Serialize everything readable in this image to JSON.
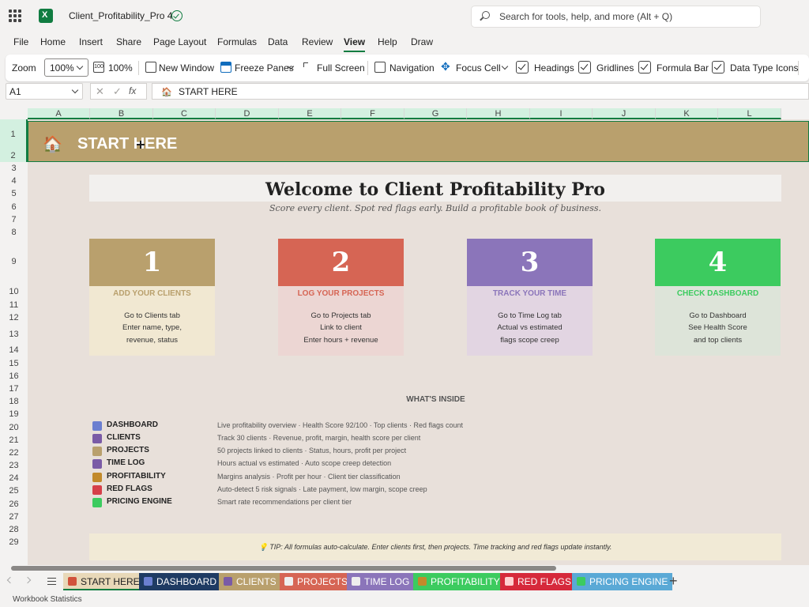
{
  "title_bar": {
    "doc_title": "Client_Profitability_Pro 4",
    "search_placeholder": "Search for tools, help, and more (Alt + Q)"
  },
  "menu": [
    "File",
    "Home",
    "Insert",
    "Share",
    "Page Layout",
    "Formulas",
    "Data",
    "Review",
    "View",
    "Help",
    "Draw"
  ],
  "active_menu": "View",
  "ribbon": {
    "zoom_label": "Zoom",
    "zoom_value": "100%",
    "zoom_100": "100%",
    "new_window": "New Window",
    "freeze_panes": "Freeze Panes",
    "full_screen": "Full Screen",
    "navigation": "Navigation",
    "focus_cell": "Focus Cell",
    "headings": "Headings",
    "gridlines": "Gridlines",
    "formula_bar": "Formula Bar",
    "data_type_icons": "Data Type Icons"
  },
  "formula_bar": {
    "cell_ref": "A1",
    "fx": "fx",
    "content": "START HERE"
  },
  "columns": [
    "A",
    "B",
    "C",
    "D",
    "E",
    "F",
    "G",
    "H",
    "I",
    "J",
    "K",
    "L"
  ],
  "rows": [
    "1",
    "2",
    "3",
    "4",
    "5",
    "6",
    "7",
    "8",
    "9",
    "10",
    "11",
    "12",
    "13",
    "14",
    "15",
    "16",
    "17",
    "18",
    "19",
    "20",
    "21",
    "22",
    "23",
    "24",
    "25",
    "26",
    "27",
    "28",
    "29"
  ],
  "sheet": {
    "banner_title": "START HERE",
    "welcome": "Welcome to Client Profitability Pro",
    "tagline": "Score every client. Spot red flags early. Build a profitable book of business.",
    "steps": [
      {
        "num": "1",
        "title": "ADD YOUR CLIENTS",
        "lines": [
          "Go to Clients tab",
          "Enter name, type,",
          "revenue, status"
        ],
        "top_color": "#b9a06d",
        "bottom_color": "#f1e8d2",
        "title_color": "#b9a06d"
      },
      {
        "num": "2",
        "title": "LOG YOUR PROJECTS",
        "lines": [
          "Go to Projects tab",
          "Link to client",
          "Enter hours + revenue"
        ],
        "top_color": "#d66554",
        "bottom_color": "#ecd6d3",
        "title_color": "#d66554"
      },
      {
        "num": "3",
        "title": "TRACK YOUR TIME",
        "lines": [
          "Go to Time Log tab",
          "Actual vs estimated",
          "flags scope creep"
        ],
        "top_color": "#8b75ba",
        "bottom_color": "#e2d5e2",
        "title_color": "#8b75ba"
      },
      {
        "num": "4",
        "title": "CHECK DASHBOARD",
        "lines": [
          "Go to Dashboard",
          "See Health Score",
          "and top clients"
        ],
        "top_color": "#3ccb5f",
        "bottom_color": "#dde4d9",
        "title_color": "#3ccb5f"
      }
    ],
    "inside_title": "WHAT'S INSIDE",
    "features": [
      {
        "name": "DASHBOARD",
        "desc": "Live profitability overview · Health Score 92/100 · Top clients · Red flags count",
        "icon_color": "#6b7fd0"
      },
      {
        "name": "CLIENTS",
        "desc": "Track 30 clients · Revenue, profit, margin, health score per client",
        "icon_color": "#7a5ba6"
      },
      {
        "name": "PROJECTS",
        "desc": "50 projects linked to clients · Status, hours, profit per project",
        "icon_color": "#b9a06d"
      },
      {
        "name": "TIME LOG",
        "desc": "Hours actual vs estimated · Auto scope creep detection",
        "icon_color": "#7a5ba6"
      },
      {
        "name": "PROFITABILITY",
        "desc": "Margins analysis · Profit per hour · Client tier classification",
        "icon_color": "#c28a2b"
      },
      {
        "name": "RED FLAGS",
        "desc": "Auto-detect 5 risk signals · Late payment, low margin, scope creep",
        "icon_color": "#d6404a"
      },
      {
        "name": "PRICING ENGINE",
        "desc": "Smart rate recommendations per client tier",
        "icon_color": "#3ccb5f"
      }
    ],
    "tip": "TIP: All formulas auto-calculate. Enter clients first, then projects. Time tracking and red flags update instantly."
  },
  "tabs": [
    {
      "label": "START HERE",
      "bg": "#e8d8b8",
      "fg": "#222222",
      "icon_color": "#d1523b"
    },
    {
      "label": "DASHBOARD",
      "bg": "#1f3b63",
      "fg": "#ffffff",
      "icon_color": "#6b7fd0"
    },
    {
      "label": "CLIENTS",
      "bg": "#b9a06d",
      "fg": "#ffffff",
      "icon_color": "#7a5ba6"
    },
    {
      "label": "PROJECTS",
      "bg": "#d66554",
      "fg": "#ffffff",
      "icon_color": "#eeeeee"
    },
    {
      "label": "TIME LOG",
      "bg": "#8b75ba",
      "fg": "#ffffff",
      "icon_color": "#eeeeee"
    },
    {
      "label": "PROFITABILITY",
      "bg": "#3ccb5f",
      "fg": "#ffffff",
      "icon_color": "#c28a2b"
    },
    {
      "label": "RED FLAGS",
      "bg": "#d6293b",
      "fg": "#ffffff",
      "icon_color": "#ffd0d0"
    },
    {
      "label": "PRICING ENGINE",
      "bg": "#5aa9d6",
      "fg": "#ffffff",
      "icon_color": "#3ccb5f"
    }
  ],
  "status": "Workbook Statistics"
}
